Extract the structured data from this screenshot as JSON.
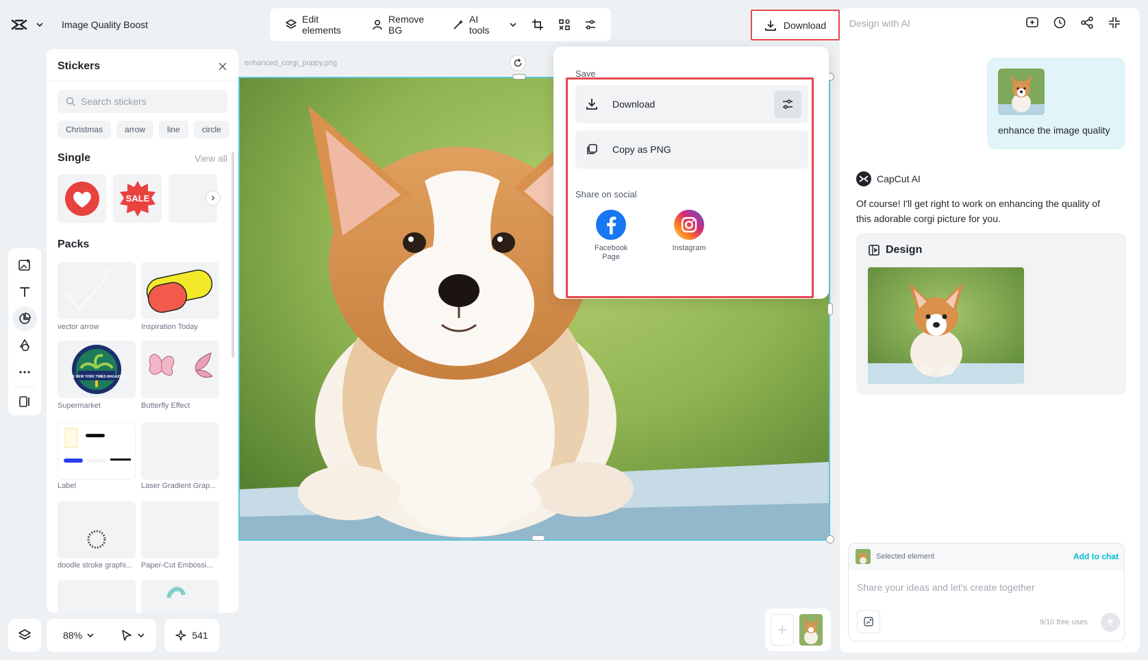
{
  "app": {
    "title": "Image Quality Boost"
  },
  "toolbar": {
    "edit_elements": "Edit elements",
    "remove_bg": "Remove BG",
    "ai_tools": "AI tools"
  },
  "download_button": "Download",
  "right_panel": {
    "title": "Design with AI",
    "user_message": "enhance the image quality",
    "ai_name": "CapCut AI",
    "ai_message": "Of course! I'll get right to work on enhancing the quality of this adorable corgi picture for you.",
    "design_label": "Design",
    "selected_element": "Selected element",
    "add_to_chat": "Add to chat",
    "chat_placeholder": "Share your ideas and let's create together",
    "free_uses": "9/10 free uses"
  },
  "stickers": {
    "title": "Stickers",
    "search_placeholder": "Search stickers",
    "chips": [
      "Christmas",
      "arrow",
      "line",
      "circle"
    ],
    "single_title": "Single",
    "view_all": "View all",
    "sale_text": "SALE",
    "packs_title": "Packs",
    "packs": [
      {
        "label": "vector arrow"
      },
      {
        "label": "Inspiration Today"
      },
      {
        "label": "Supermarket"
      },
      {
        "label": "Butterfly Effect"
      },
      {
        "label": "Label"
      },
      {
        "label": "Laser Gradient Grap..."
      },
      {
        "label": "doodle stroke graphi..."
      },
      {
        "label": "Paper-Cut Embossi..."
      }
    ],
    "badge_text": "THE NEW YORK TIMES MAGAZINE"
  },
  "canvas": {
    "filename": "enhanced_corgi_puppy.png"
  },
  "popup": {
    "save_label": "Save",
    "download": "Download",
    "copy_png": "Copy as PNG",
    "share_label": "Share on social",
    "facebook": "Facebook Page",
    "instagram": "Instagram"
  },
  "bottom": {
    "zoom": "88%",
    "credits": "541"
  },
  "colors": {
    "accent": "#00bcd4",
    "highlight": "#e5484d",
    "chat_bubble": "#e1f5f8"
  }
}
